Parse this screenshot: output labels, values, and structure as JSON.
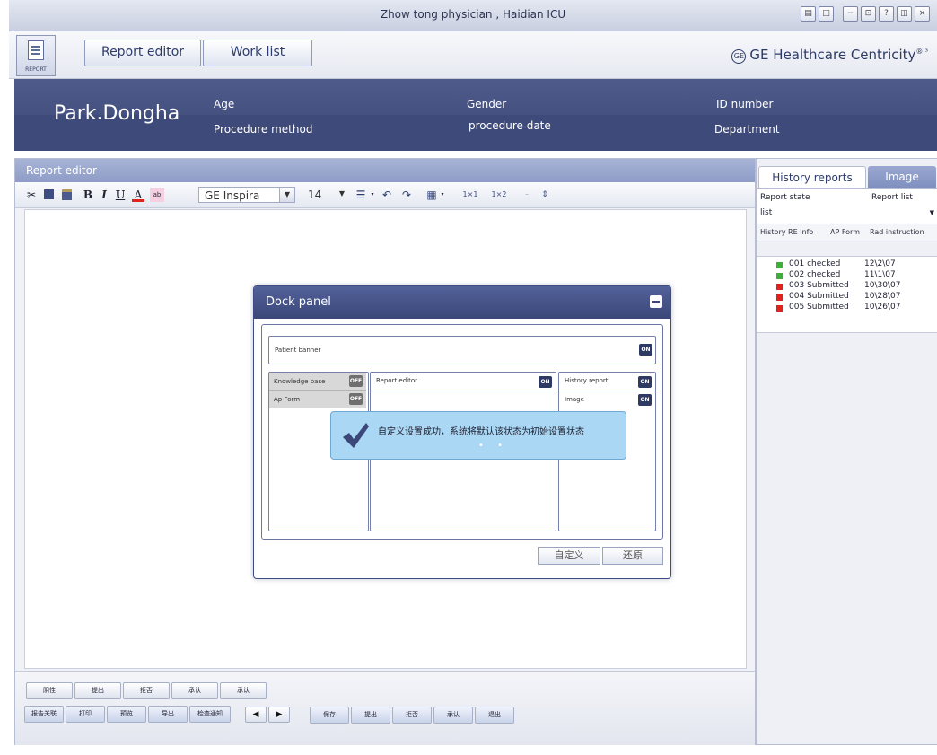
{
  "window": {
    "title": "Zhow tong physician , Haidian ICU",
    "controls": [
      "▤",
      "□",
      "−",
      "⊡",
      "?",
      "◫",
      "×"
    ]
  },
  "topbar": {
    "report_icon_caption": "REPORT",
    "tabs": [
      "Report editor",
      "Work list"
    ],
    "brand": "GE Healthcare Centricity",
    "brand_suffix": "®I³"
  },
  "patient": {
    "name": "Park.Dongha",
    "age_label": "Age",
    "gender_label": "Gender",
    "id_label": "ID number",
    "procedure_method_label": "Procedure method",
    "procedure_date_label": "procedure date",
    "department_label": "Department"
  },
  "editor": {
    "title": "Report editor",
    "font": "GE Inspira",
    "font_size": "14",
    "toolbar": {
      "bold": "B",
      "italic": "I",
      "underline": "U",
      "font_color": "A",
      "highlight": "ab",
      "superscript": "1×1",
      "subscript": "1×2"
    }
  },
  "dock_panel": {
    "title": "Dock panel",
    "patient_banner": {
      "label": "Patient banner",
      "state": "ON"
    },
    "knowledge_base": {
      "label": "Knowledge base",
      "state": "OFF"
    },
    "ap_form": {
      "label": "Ap Form",
      "state": "OFF"
    },
    "report_editor": {
      "label": "Report editor",
      "state": "ON"
    },
    "history_report": {
      "label": "History report",
      "state": "ON"
    },
    "image": {
      "label": "Image",
      "state": "ON"
    },
    "toast_message": "自定义设置成功，系统将默认该状态为初始设置状态",
    "toast_dots": "• •",
    "customize_label": "自定义",
    "restore_label": "还原"
  },
  "bottom_buttons": {
    "row1": [
      "阴性",
      "提出",
      "拒否",
      "承认",
      "承认"
    ],
    "row2a": [
      "报告关联",
      "打印",
      "预览",
      "导出",
      "检查通知"
    ],
    "nav_prev": "◀",
    "nav_next": "▶",
    "row2b": [
      "保存",
      "提出",
      "拒否",
      "承认",
      "退出"
    ]
  },
  "history": {
    "tabs": [
      "History reports",
      "Image"
    ],
    "report_state_label": "Report state",
    "report_list_label": "Report list",
    "list_label": "list",
    "subtabs": [
      "History RE Info",
      "AP Form",
      "Rad instruction"
    ],
    "items": [
      {
        "no": "001",
        "status": "checked",
        "date": "12\\2\\07",
        "color": "#3fae3a"
      },
      {
        "no": "002",
        "status": "checked",
        "date": "11\\1\\07",
        "color": "#3fae3a"
      },
      {
        "no": "003",
        "status": "Submitted",
        "date": "10\\30\\07",
        "color": "#e0231c"
      },
      {
        "no": "004",
        "status": "Submitted",
        "date": "10\\28\\07",
        "color": "#e0231c"
      },
      {
        "no": "005",
        "status": "Submitted",
        "date": "10\\26\\07",
        "color": "#e0231c"
      }
    ]
  },
  "colors": {
    "banner": "#3e4a7a",
    "accent": "#2d3c6c",
    "toast": "#aad7f3"
  }
}
